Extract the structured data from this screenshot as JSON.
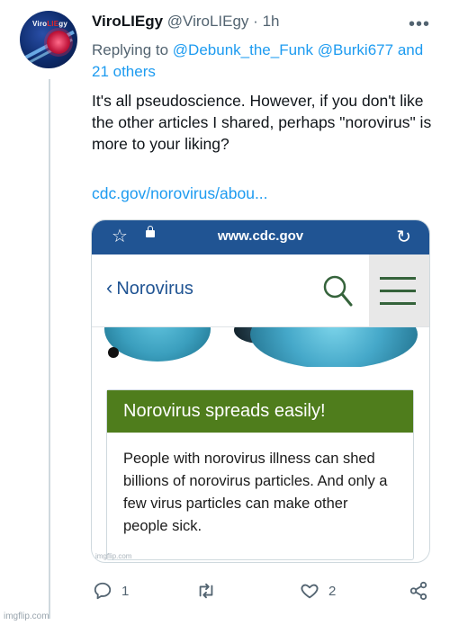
{
  "tweet": {
    "author_name": "ViroLIEgy",
    "author_handle": "@ViroLIEgy",
    "separator": "·",
    "time": "1h",
    "avatar_logo_prefix": "Viro",
    "avatar_logo_highlight": "LIE",
    "avatar_logo_suffix": "gy",
    "replying_to_label": "Replying to",
    "mentions": [
      "@Debunk_the_Funk",
      "@Burki677"
    ],
    "and_others": "and 21 others",
    "text": "It's all pseudoscience. However, if you don't like the other articles I shared, perhaps \"norovirus\" is more to your liking?",
    "link_text": "cdc.gov/norovirus/abou..."
  },
  "card": {
    "url": "www.cdc.gov",
    "back_label": "Norovirus",
    "callout_title": "Norovirus spreads easily!",
    "callout_text": "People with norovirus illness can shed billions of norovirus particles. And only a few virus particles can make other people sick.",
    "watermark": "imgflip.com"
  },
  "actions": {
    "reply_count": "1",
    "retweet_count": "",
    "like_count": "2"
  },
  "footer_watermark": "imgflip.com",
  "colors": {
    "link": "#1d9bf0",
    "cdc_blue": "#205493",
    "callout_green": "#4f7d1c",
    "muted": "#536471"
  }
}
